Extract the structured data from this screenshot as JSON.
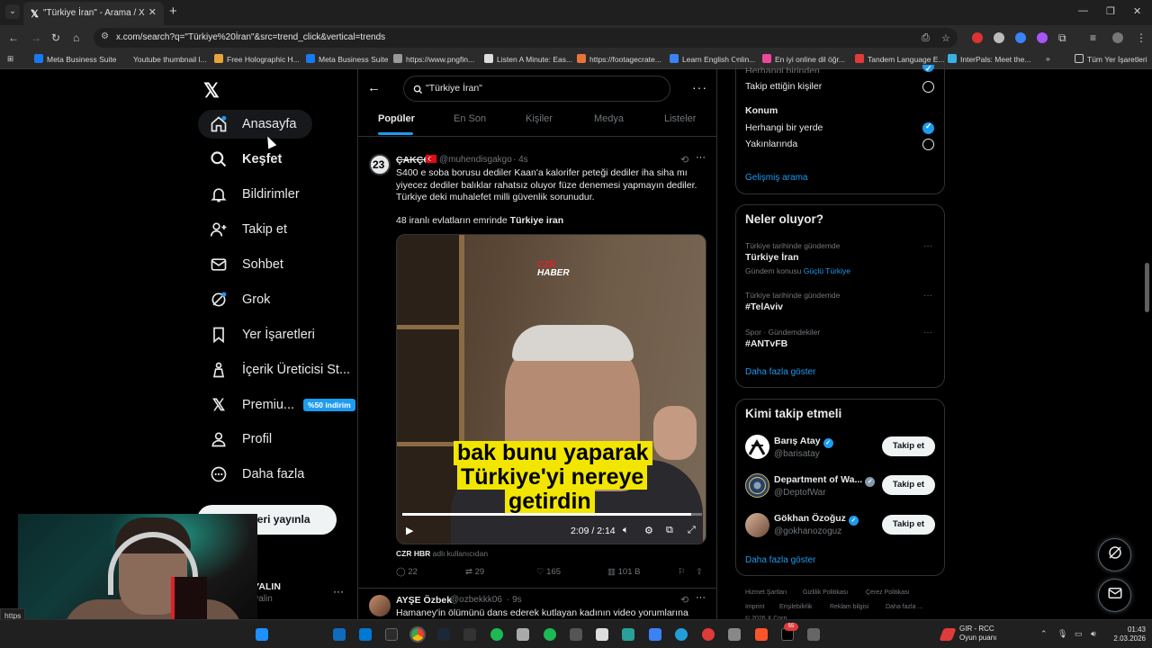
{
  "browser": {
    "tab_title": "\"Türkiye İran\" - Arama / X",
    "url": "x.com/search?q=\"Türkiye%20İran\"&src=trend_click&vertical=trends",
    "bookmarks": [
      "Meta Business Suite",
      "Youtube thumbnail l...",
      "Free Holographic H...",
      "Meta Business Suite",
      "https://www.pngfin...",
      "Listen A Minute: Eas...",
      "https://footagecrate...",
      "Learn English Onlin...",
      "En iyi online dil öğr...",
      "Tandem Language E...",
      "InterPals: Meet the..."
    ],
    "all_bookmarks": "Tüm Yer İşaretleri",
    "status_url": "https"
  },
  "nav": {
    "items": [
      {
        "label": "Anasayfa",
        "icon": "home-icon"
      },
      {
        "label": "Keşfet",
        "icon": "search-icon"
      },
      {
        "label": "Bildirimler",
        "icon": "bell-icon"
      },
      {
        "label": "Takip et",
        "icon": "person-add-icon"
      },
      {
        "label": "Sohbet",
        "icon": "mail-icon"
      },
      {
        "label": "Grok",
        "icon": "grok-icon"
      },
      {
        "label": "Yer İşaretleri",
        "icon": "bookmark-icon"
      },
      {
        "label": "İçerik Üreticisi St...",
        "icon": "creator-icon"
      },
      {
        "label": "Premiu...",
        "icon": "x-logo-icon"
      },
      {
        "label": "Profil",
        "icon": "profile-icon"
      },
      {
        "label": "Daha fazla",
        "icon": "more-circle-icon"
      }
    ],
    "premium_badge": "%50 indirim",
    "post_button": "deri yayınla",
    "account_name": "han YALIN",
    "account_handle": "uhanyalin"
  },
  "search": {
    "query": "\"Türkiye İran\"",
    "tabs": [
      "Popüler",
      "En Son",
      "Kişiler",
      "Medya",
      "Listeler"
    ]
  },
  "tweet1": {
    "avatar_text": "23",
    "name": "ÇAKÇO",
    "handle": "@muhendisgakgo",
    "time": "· 4s",
    "text1": "S400 e soba borusu dediler Kaan'a kalorifer peteği dediler iha siha mı yiyecez dediler balıklar rahatsız oluyor füze denemesi yapmayın dediler. Türkiye deki muhalefet milli güvenlik sorunudur.",
    "text2_prefix": "48 iranlı evlatların emrinde ",
    "text2_bold": "Türkiye iran",
    "video": {
      "logo_line1": "CZR",
      "logo_line2": "HABER",
      "caption1": "bak bunu yaparak",
      "caption2": "Türkiye'yi nereye",
      "caption3": "getirdin",
      "time": "2:09 / 2:14",
      "progress": 0.963
    },
    "source_name": "CZR HBR",
    "source_suffix": " adlı kullanıcıdan",
    "replies": "22",
    "retweets": "29",
    "likes": "165",
    "views": "101 B"
  },
  "tweet2": {
    "name": "AYŞE Özbek",
    "handle": "@ozbekkk06",
    "time": "· 9s",
    "text": "Hamaney'in ölümünü dans ederek kutlayan kadının video yorumlarına"
  },
  "filters": {
    "people_partial": "Herhangi birinden",
    "people_following": "Takip ettiğin kişiler",
    "location_title": "Konum",
    "location_anywhere": "Herhangi bir yerde",
    "location_near": "Yakınlarında",
    "advanced": "Gelişmiş arama"
  },
  "trends": {
    "title": "Neler oluyor?",
    "items": [
      {
        "context": "Türkiye tarihinde gündemde",
        "name": "Türkiye İran",
        "sub_prefix": "Gündem konusu ",
        "sub_link": "Güçlü Türkiye"
      },
      {
        "context": "Türkiye tarihinde gündemde",
        "name": "#TelAviv"
      },
      {
        "context": "Spor · Gündemdekiler",
        "name": "#ANTvFB"
      }
    ],
    "more": "Daha fazla göster"
  },
  "who_to_follow": {
    "title": "Kimi takip etmeli",
    "users": [
      {
        "name": "Barış Atay",
        "handle": "@barisatay",
        "verified": "blue"
      },
      {
        "name": "Department of Wa...",
        "handle": "@DeptofWar",
        "verified": "gray"
      },
      {
        "name": "Gökhan Özoğuz",
        "handle": "@gokhanozoguz",
        "verified": "blue"
      }
    ],
    "follow_label": "Takip et",
    "more": "Daha fazla göster"
  },
  "footer": {
    "links": [
      "Hizmet Şartları",
      "Gizlilik Politikası",
      "Çerez Politikası",
      "Imprint",
      "Erişilebilirlik",
      "Reklam bilgisi",
      "Daha fazla ..."
    ],
    "copyright": "© 2026 X Corp."
  },
  "taskbar": {
    "game_title": "GIR - RCC",
    "game_sub": "Oyun puanı",
    "time": "01:43",
    "date": "2.03.2026",
    "notification_count": "55"
  },
  "colors": {
    "accent": "#1d9bf0",
    "text": "#e7e9ea",
    "muted": "#71767b",
    "border": "#2f3336",
    "caption_bg": "#f2e600"
  }
}
